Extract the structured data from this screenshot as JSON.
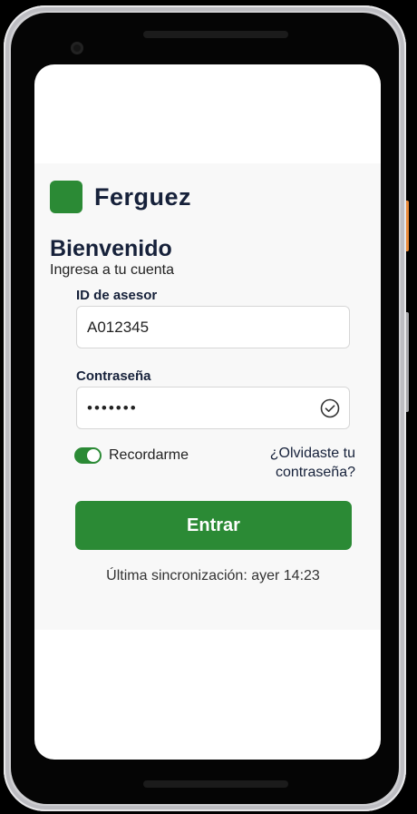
{
  "brand": {
    "name": "Ferguez",
    "color": "#2b8a35"
  },
  "login": {
    "title": "Bienvenido",
    "subtitle": "Ingresa a tu cuenta",
    "id_label": "ID de asesor",
    "id_value": "A012345",
    "password_label": "Contraseña",
    "password_value": "•••••••",
    "remember_label": "Recordarme",
    "remember_checked": true,
    "forgot_label": "¿Olvidaste tu contraseña?",
    "submit_label": "Entrar",
    "sync_status": "Última sincronización: ayer 14:23"
  },
  "icons": {
    "password_status": "check-circle-icon",
    "logo": "square-logo-icon"
  },
  "colors": {
    "accent": "#2b8a35",
    "text_dark": "#16213a",
    "panel_bg": "#f8f8f8"
  }
}
